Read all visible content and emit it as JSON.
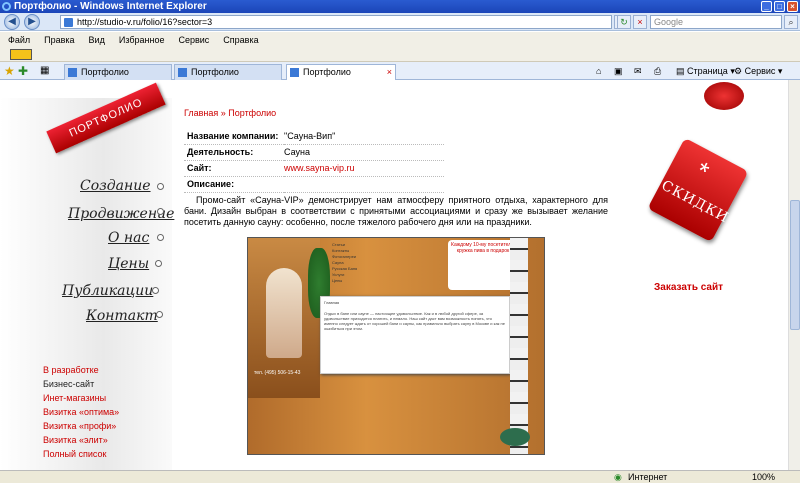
{
  "window": {
    "title": "Портфолио - Windows Internet Explorer"
  },
  "address": {
    "url": "http://studio-v.ru/folio/16?sector=3",
    "search_placeholder": "Google"
  },
  "menu": [
    "Файл",
    "Правка",
    "Вид",
    "Избранное",
    "Сервис",
    "Справка"
  ],
  "tabs": [
    "Портфолио",
    "Портфолио",
    "Портфолио"
  ],
  "toolbar": {
    "page": "Страница",
    "service": "Сервис"
  },
  "site": {
    "ribbon": "ПОРТФОЛИО",
    "nav": [
      "Создание",
      "Продвижение",
      "О нас",
      "Цены",
      "Публикации",
      "Контакт"
    ],
    "side_links": [
      "В разработке",
      "Бизнес-сайт",
      "Инет-магазины",
      "Визитка «оптима»",
      "Визитка «профи»",
      "Визитка «элит»",
      "Полный список"
    ],
    "breadcrumb": {
      "home": "Главная",
      "sep": " » ",
      "current": "Портфолио"
    },
    "info": [
      {
        "label": "Название компании:",
        "value": "\"Сауна-Вип\""
      },
      {
        "label": "Деятельность:",
        "value": "Сауна"
      },
      {
        "label": "Сайт:",
        "value": "www.sayna-vip.ru"
      },
      {
        "label": "Описание:",
        "value": ""
      }
    ],
    "description": "Промо-сайт «Сауна-VIP» демонстрирует нам атмосферу приятного отдыха, характерного для бани. Дизайн выбран в соответствии с принятыми ассоциациями и сразу же вызывает желание посетить данную сауну: особенно, после тяжелого рабочего дня или на праздники.",
    "screenshot": {
      "menu": [
        "Статьи",
        "Контакты",
        "Фотогалереи",
        "Сауна",
        "Русская Баня",
        "Услуги",
        "Цены"
      ],
      "promo": "Каждому 10-му посетителю кружка пива в подарок",
      "body_title": "Главная",
      "body_text": "Отдых в бане или сауне — настоящее удовольствие. Как и в любой другой сфере, за удовольствие приходится платить, и немало. Наш сайт даст вам возможность понять, что именно следует ждать от хорошей бани и сауны, как правильно выбрать сауну в Москве и как не ошибиться при этом.",
      "phone": "тел. (495) 506-15-43"
    },
    "tag": "СКИДКИ",
    "order_link": "Заказать сайт"
  },
  "status": {
    "zone": "Интернет",
    "zoom": "100%"
  }
}
